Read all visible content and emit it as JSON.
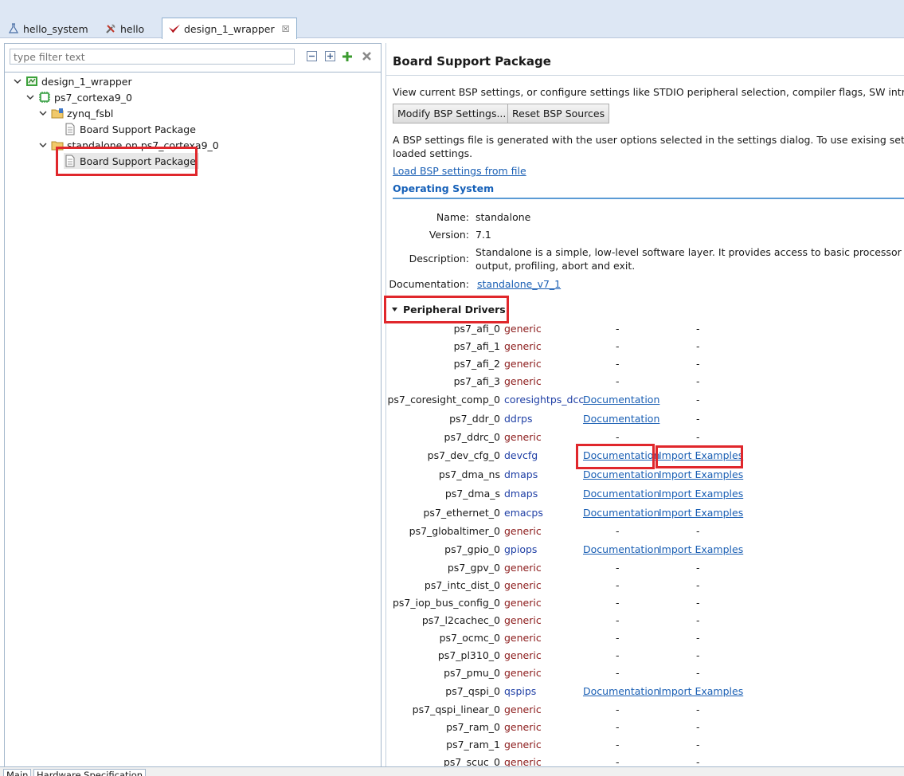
{
  "tabs": [
    {
      "label": "hello_system",
      "icon": "flask-icon"
    },
    {
      "label": "hello",
      "icon": "tools-icon"
    },
    {
      "label": "design_1_wrapper",
      "icon": "vivado-logo-icon",
      "close": "☒"
    }
  ],
  "filter": {
    "placeholder": "type filter text"
  },
  "tree": {
    "root": "design_1_wrapper",
    "processor": "ps7_cortexa9_0",
    "fsbl": "zynq_fsbl",
    "fsbl_bsp": "Board Support Package",
    "standalone": "standalone on ps7_cortexa9_0",
    "standalone_bsp": "Board Support Package"
  },
  "main": {
    "title": "Board Support Package",
    "description": "View current BSP settings, or configure settings like STDIO peripheral selection, compiler flags, SW intrusive pr",
    "modify_button": "Modify BSP Settings...",
    "reset_button": "Reset BSP Sources",
    "settings_line1": "A BSP settings file is generated with the user options selected in the settings dialog. To use exising settings, cli",
    "settings_line2": "loaded settings.",
    "load_link": "Load BSP settings from file",
    "os_section": "Operating System",
    "os": {
      "name_label": "Name:",
      "name": "standalone",
      "version_label": "Version:",
      "version": "7.1",
      "description_label": "Description:",
      "description_line1": "Standalone is a simple, low-level software layer. It provides access to basic processor featur",
      "description_line2": "output, profiling, abort and exit.",
      "documentation_label": "Documentation:",
      "documentation_link": "standalone_v7_1"
    },
    "peripheral_section": "Peripheral Drivers",
    "drivers": [
      {
        "name": "ps7_afi_0",
        "driver": "generic",
        "doc": "-",
        "examples": "-"
      },
      {
        "name": "ps7_afi_1",
        "driver": "generic",
        "doc": "-",
        "examples": "-"
      },
      {
        "name": "ps7_afi_2",
        "driver": "generic",
        "doc": "-",
        "examples": "-"
      },
      {
        "name": "ps7_afi_3",
        "driver": "generic",
        "doc": "-",
        "examples": "-"
      },
      {
        "name": "ps7_coresight_comp_0",
        "driver": "coresightps_dcc",
        "doc": "Documentation",
        "examples": "-"
      },
      {
        "name": "ps7_ddr_0",
        "driver": "ddrps",
        "doc": "Documentation",
        "examples": "-"
      },
      {
        "name": "ps7_ddrc_0",
        "driver": "generic",
        "doc": "-",
        "examples": "-"
      },
      {
        "name": "ps7_dev_cfg_0",
        "driver": "devcfg",
        "doc": "Documentation",
        "examples": "Import Examples"
      },
      {
        "name": "ps7_dma_ns",
        "driver": "dmaps",
        "doc": "Documentation",
        "examples": "Import Examples"
      },
      {
        "name": "ps7_dma_s",
        "driver": "dmaps",
        "doc": "Documentation",
        "examples": "Import Examples"
      },
      {
        "name": "ps7_ethernet_0",
        "driver": "emacps",
        "doc": "Documentation",
        "examples": "Import Examples"
      },
      {
        "name": "ps7_globaltimer_0",
        "driver": "generic",
        "doc": "-",
        "examples": "-"
      },
      {
        "name": "ps7_gpio_0",
        "driver": "gpiops",
        "doc": "Documentation",
        "examples": "Import Examples"
      },
      {
        "name": "ps7_gpv_0",
        "driver": "generic",
        "doc": "-",
        "examples": "-"
      },
      {
        "name": "ps7_intc_dist_0",
        "driver": "generic",
        "doc": "-",
        "examples": "-"
      },
      {
        "name": "ps7_iop_bus_config_0",
        "driver": "generic",
        "doc": "-",
        "examples": "-"
      },
      {
        "name": "ps7_l2cachec_0",
        "driver": "generic",
        "doc": "-",
        "examples": "-"
      },
      {
        "name": "ps7_ocmc_0",
        "driver": "generic",
        "doc": "-",
        "examples": "-"
      },
      {
        "name": "ps7_pl310_0",
        "driver": "generic",
        "doc": "-",
        "examples": "-"
      },
      {
        "name": "ps7_pmu_0",
        "driver": "generic",
        "doc": "-",
        "examples": "-"
      },
      {
        "name": "ps7_qspi_0",
        "driver": "qspips",
        "doc": "Documentation",
        "examples": "Import Examples"
      },
      {
        "name": "ps7_qspi_linear_0",
        "driver": "generic",
        "doc": "-",
        "examples": "-"
      },
      {
        "name": "ps7_ram_0",
        "driver": "generic",
        "doc": "-",
        "examples": "-"
      },
      {
        "name": "ps7_ram_1",
        "driver": "generic",
        "doc": "-",
        "examples": "-"
      },
      {
        "name": "ps7_scuc_0",
        "driver": "generic",
        "doc": "-",
        "examples": "-"
      }
    ]
  },
  "bottom_tabs": [
    "Main",
    "Hardware Specification"
  ],
  "colors": {
    "highlight": "#e0272c",
    "link": "#1a5fb4",
    "section": "#1560b8",
    "generic": "#8b1a1a",
    "driver": "#1f3fa5"
  }
}
